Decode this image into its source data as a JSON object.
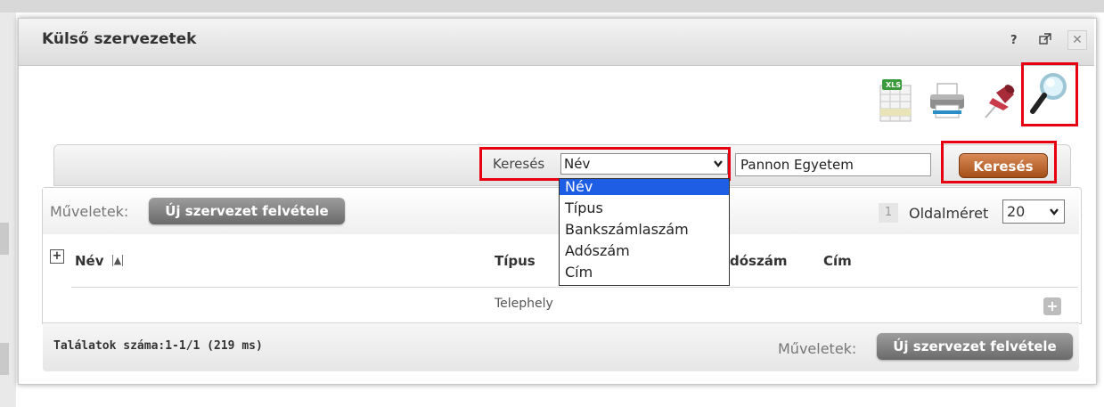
{
  "window": {
    "title": "Külső szervezetek",
    "help_icon": "?",
    "popout_icon": "popout-icon",
    "close_icon": "✕"
  },
  "toolbar": {
    "icons": [
      "xls-export-icon",
      "print-icon",
      "pin-icon",
      "magnifier-icon"
    ],
    "xls_label": "XLS"
  },
  "search": {
    "label": "Keresés",
    "field_selected": "Név",
    "field_options": [
      "Név",
      "Típus",
      "Bankszámlaszám",
      "Adószám",
      "Cím"
    ],
    "value": "Pannon Egyetem",
    "button_label": "Keresés"
  },
  "panel": {
    "actions_label": "Műveletek:",
    "new_org_button": "Új szervezet felvétele",
    "page_number": "1",
    "page_size_label": "Oldalméret",
    "page_size_value": "20"
  },
  "table": {
    "columns": [
      "Név",
      "Típus",
      "Adószám",
      "Cím"
    ],
    "partial_column_adoszam": "dószám",
    "rows": [
      {
        "tipus": "Telephely"
      }
    ]
  },
  "footer": {
    "results_text": "Találatok száma:1-1/1 (219 ms)",
    "actions_label": "Műveletek:",
    "new_org_button": "Új szervezet felvétele"
  },
  "colors": {
    "highlight": "#e60012",
    "search_button": "#b85a22",
    "dropdown_selected": "#1e5ee5"
  }
}
